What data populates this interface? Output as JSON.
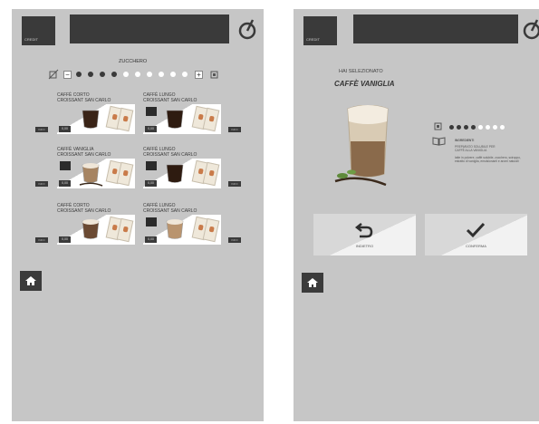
{
  "selection_screen": {
    "credit_label": "CREDIT",
    "sugar": {
      "title": "ZUCCHERO",
      "level": 4,
      "max": 10,
      "minus": "−",
      "plus": "+"
    },
    "products": [
      {
        "name": "CAFFÈ CORTO",
        "extra": "CROISSANT SAN CARLO",
        "price": "0,00",
        "info": "INFO",
        "drink": "short"
      },
      {
        "name": "CAFFÈ LUNGO",
        "extra": "CROISSANT SAN CARLO",
        "price": "0,00",
        "info": "INFO",
        "drink": "long"
      },
      {
        "name": "CAFFÈ VANIGLIA",
        "extra": "CROISSANT SAN CARLO",
        "price": "0,00",
        "info": "INFO",
        "drink": "vanilla"
      },
      {
        "name": "CAFFÈ LUNGO",
        "extra": "CROISSANT SAN CARLO",
        "price": "0,00",
        "info": "INFO",
        "drink": "long"
      },
      {
        "name": "CAFFÈ CORTO",
        "extra": "CROISSANT SAN CARLO",
        "price": "0,00",
        "info": "INFO",
        "drink": "cream"
      },
      {
        "name": "CAFFÈ LUNGO",
        "extra": "CROISSANT SAN CARLO",
        "price": "0,00",
        "info": "INFO",
        "drink": "cappuccino"
      }
    ]
  },
  "detail_screen": {
    "credit_label": "CREDIT",
    "selected_label": "HAI SELEZIONATO",
    "product_name": "CAFFÈ VANIGLIA",
    "sugar_level": 4,
    "sugar_max": 8,
    "ingredients_title": "INGREDIENTI",
    "ingredients_line1": "PREPARATO SOLUBILE PER",
    "ingredients_line2": "CAFFÈ ALLA VANIGLIA",
    "ingredients_body": "latte in polvere, caffè solubile, zucchero, sciroppo, estratto di vaniglia, emulsionanti e aromi naturali",
    "back_label": "INDIETRO",
    "confirm_label": "CONFERMA"
  },
  "colors": {
    "dark": "#3a3a3a",
    "screen_bg": "#c6c6c6",
    "dot_on": "#3a3a3a",
    "dot_off": "#ffffff"
  }
}
